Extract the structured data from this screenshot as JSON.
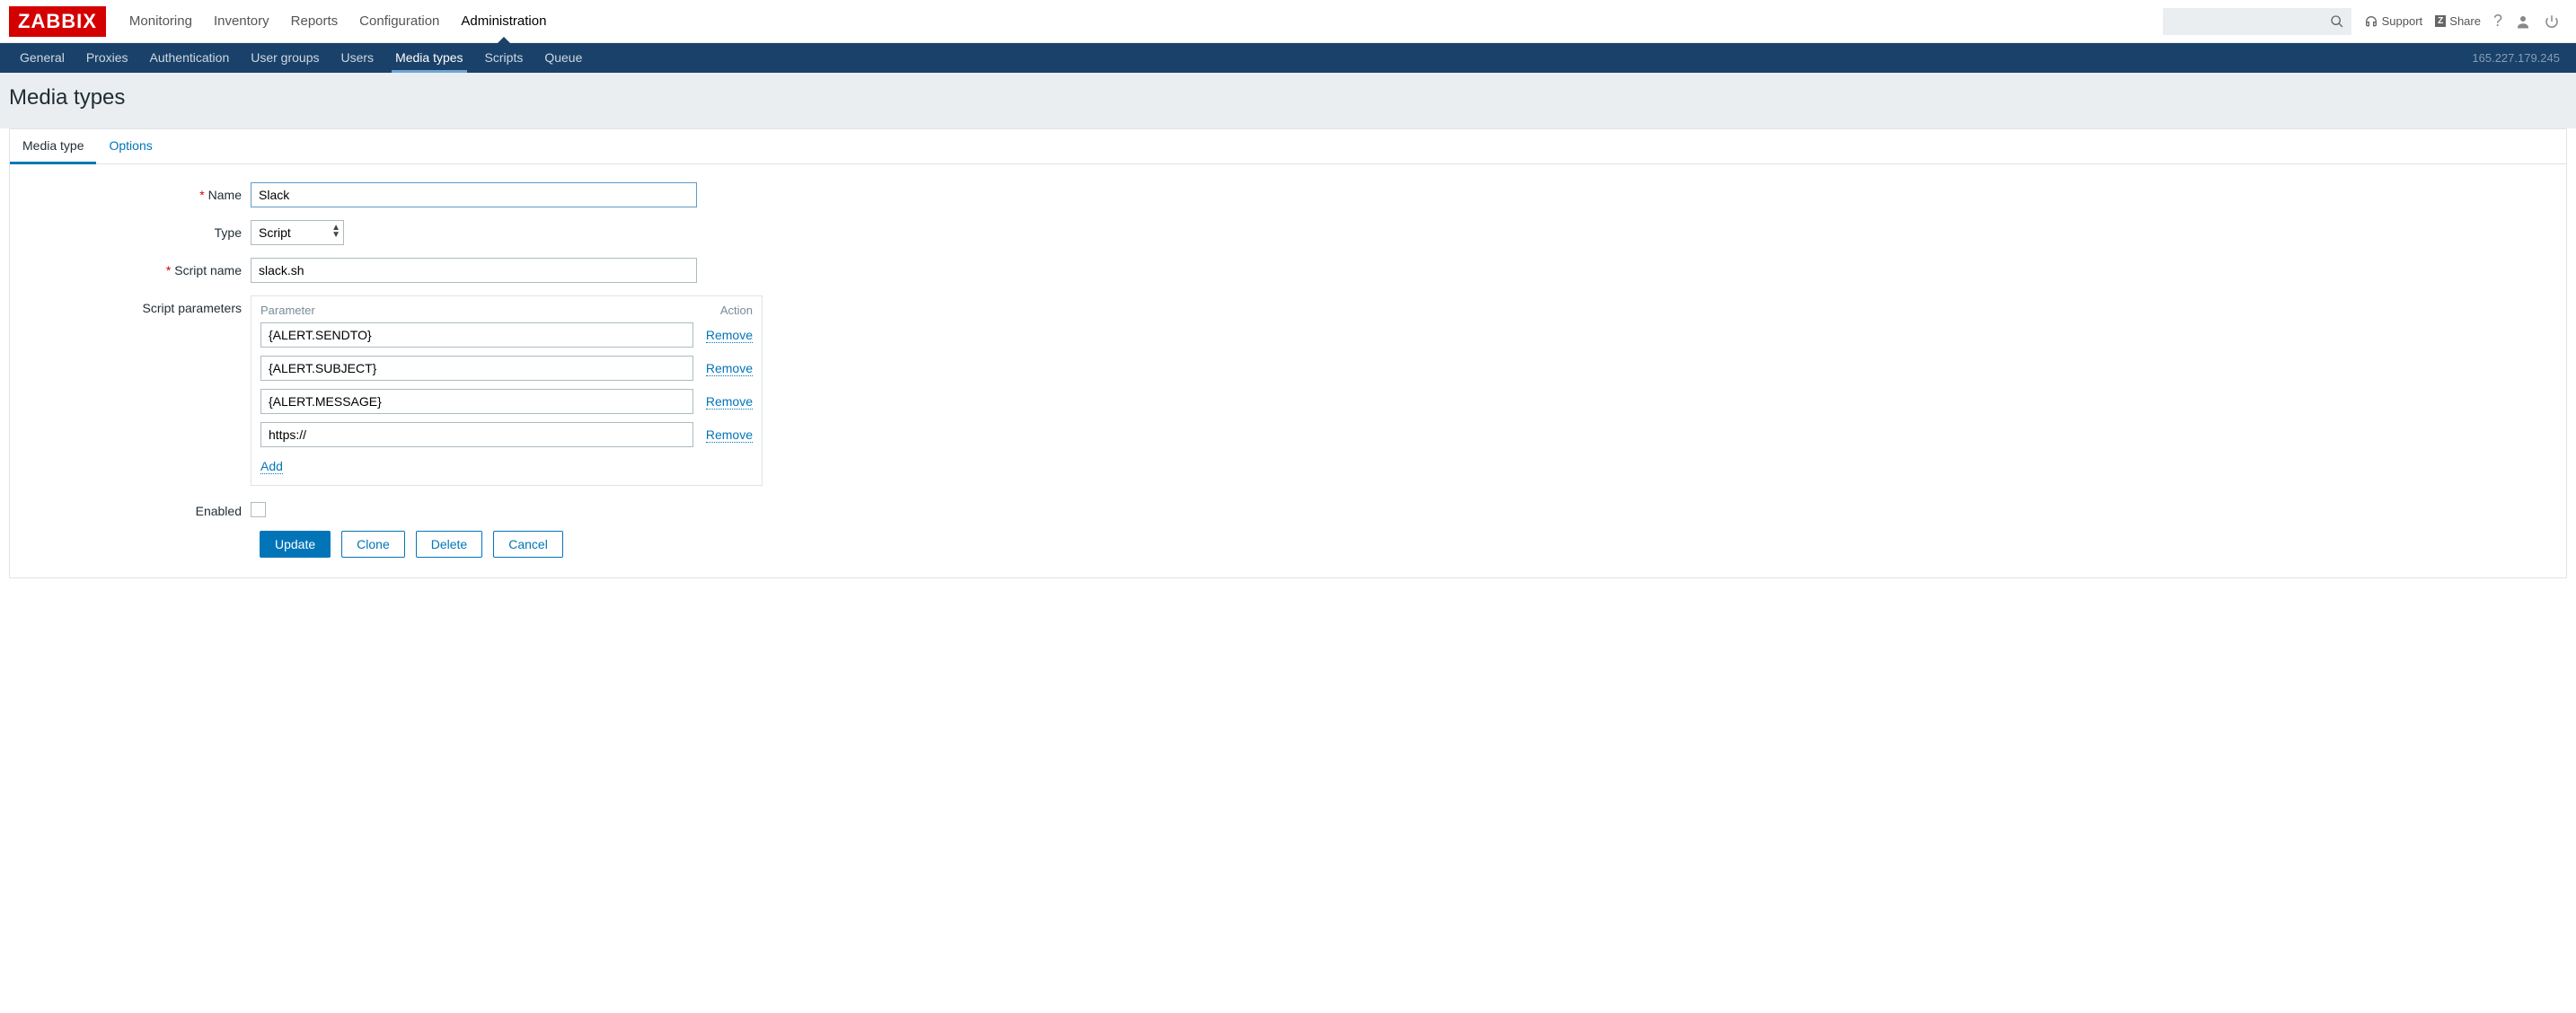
{
  "logo": "ZABBIX",
  "topnav": {
    "items": [
      "Monitoring",
      "Inventory",
      "Reports",
      "Configuration",
      "Administration"
    ],
    "active": 4,
    "support": "Support",
    "share": "Share"
  },
  "subnav": {
    "items": [
      "General",
      "Proxies",
      "Authentication",
      "User groups",
      "Users",
      "Media types",
      "Scripts",
      "Queue"
    ],
    "active": 5,
    "ip": "165.227.179.245"
  },
  "page": {
    "title": "Media types"
  },
  "tabs": {
    "items": [
      "Media type",
      "Options"
    ],
    "active": 0
  },
  "form": {
    "name_label": "Name",
    "name_value": "Slack",
    "type_label": "Type",
    "type_value": "Script",
    "script_name_label": "Script name",
    "script_name_value": "slack.sh",
    "script_params_label": "Script parameters",
    "param_header": "Parameter",
    "action_header": "Action",
    "params": [
      {
        "value": "{ALERT.SENDTO}"
      },
      {
        "value": "{ALERT.SUBJECT}"
      },
      {
        "value": "{ALERT.MESSAGE}"
      },
      {
        "value": "https://"
      }
    ],
    "remove_label": "Remove",
    "add_label": "Add",
    "enabled_label": "Enabled",
    "enabled_checked": false
  },
  "buttons": {
    "update": "Update",
    "clone": "Clone",
    "delete": "Delete",
    "cancel": "Cancel"
  }
}
